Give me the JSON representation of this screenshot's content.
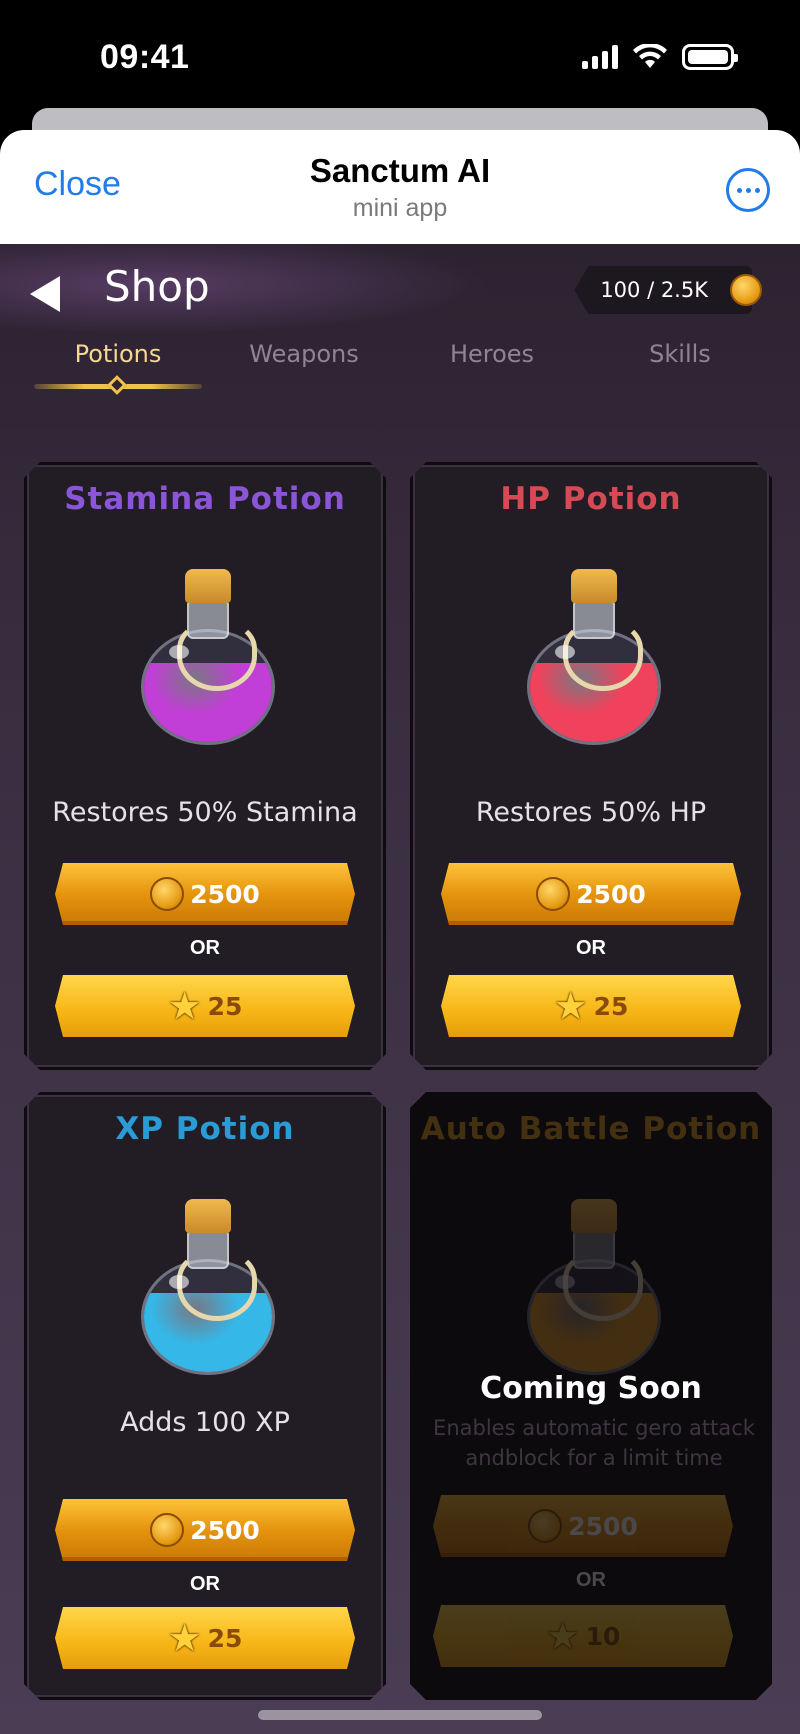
{
  "status_bar": {
    "time": "09:41"
  },
  "header": {
    "close_label": "Close",
    "title": "Sanctum AI",
    "subtitle": "mini app"
  },
  "shop": {
    "title": "Shop",
    "balance": "100 / 2.5K",
    "tabs": [
      {
        "label": "Potions",
        "active": true
      },
      {
        "label": "Weapons"
      },
      {
        "label": "Heroes"
      },
      {
        "label": "Skills"
      }
    ],
    "or_label": "OR",
    "items": [
      {
        "title": "Stamina Potion",
        "title_color": "#8a55d6",
        "liquid_color": "#c13fd6",
        "description": "Restores 50% Stamina",
        "coin_price": "2500",
        "star_price": "25"
      },
      {
        "title": "HP Potion",
        "title_color": "#d64a55",
        "liquid_color": "#f0425c",
        "description": "Restores 50% HP",
        "coin_price": "2500",
        "star_price": "25"
      },
      {
        "title": "XP Potion",
        "title_color": "#2a9bd6",
        "liquid_color": "#35b7e8",
        "description": "Adds 100 XP",
        "coin_price": "2500",
        "star_price": "25"
      },
      {
        "title": "Auto Battle Potion",
        "title_color": "#e7a21b",
        "liquid_color": "#e79a1b",
        "status": "Coming Soon",
        "description": "Enables automatic gero attack andblock for a limit time",
        "coin_price": "2500",
        "star_price": "10"
      }
    ]
  }
}
